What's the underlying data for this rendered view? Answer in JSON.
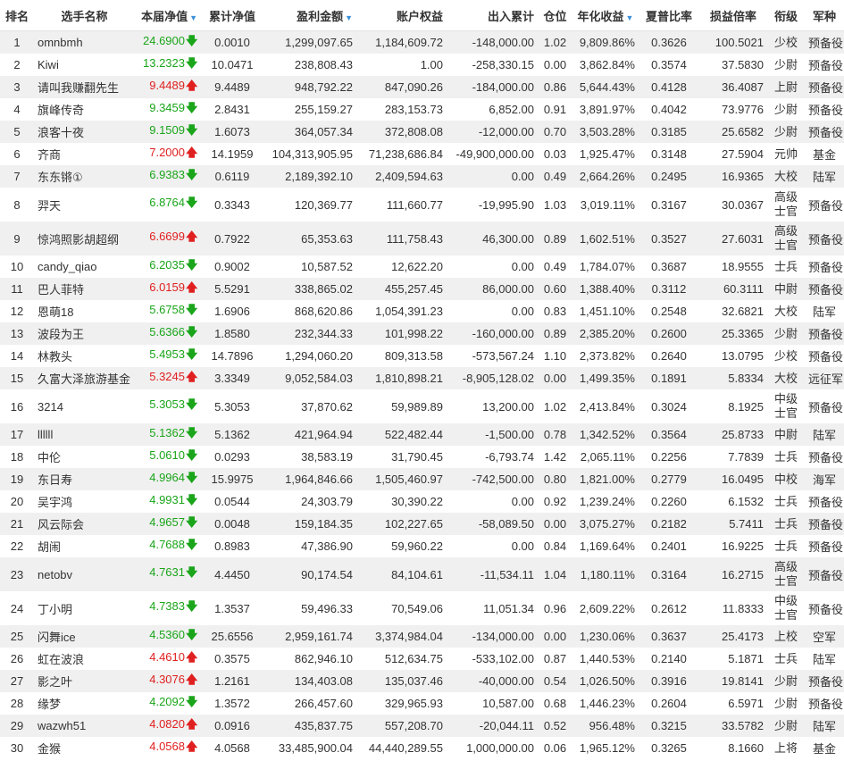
{
  "headers": [
    {
      "label": "排名",
      "sort": false
    },
    {
      "label": "选手名称",
      "sort": false
    },
    {
      "label": "本届净值",
      "sort": true
    },
    {
      "label": "累计净值",
      "sort": false
    },
    {
      "label": "盈利金额",
      "sort": true
    },
    {
      "label": "账户权益",
      "sort": false
    },
    {
      "label": "出入累计",
      "sort": false
    },
    {
      "label": "仓位",
      "sort": false
    },
    {
      "label": "年化收益",
      "sort": true
    },
    {
      "label": "夏普比率",
      "sort": false
    },
    {
      "label": "损益倍率",
      "sort": false
    },
    {
      "label": "衔级",
      "sort": false
    },
    {
      "label": "军种",
      "sort": false
    }
  ],
  "sort_arrow": "▼",
  "trend_symbols": {
    "up": "🡅",
    "down": "🡇"
  },
  "colors": {
    "up": "#e02020",
    "down": "#1aa51a",
    "accent": "#3b8fd9",
    "row_alt": "#f0f0f0"
  },
  "rows": [
    {
      "rank": "1",
      "name": "omnbmh",
      "nav": "24.6900",
      "trend": "down",
      "cum": "0.0010",
      "profit": "1,299,097.65",
      "equity": "1,184,609.72",
      "flow": "-148,000.00",
      "pos": "1.02",
      "annual": "9,809.86%",
      "sharpe": "0.3626",
      "pl": "100.5021",
      "title": "少校",
      "branch": "预备役"
    },
    {
      "rank": "2",
      "name": "Kiwi",
      "nav": "13.2323",
      "trend": "down",
      "cum": "10.0471",
      "profit": "238,808.43",
      "equity": "1.00",
      "flow": "-258,330.15",
      "pos": "0.00",
      "annual": "3,862.84%",
      "sharpe": "0.3574",
      "pl": "37.5830",
      "title": "少尉",
      "branch": "预备役"
    },
    {
      "rank": "3",
      "name": "请叫我赚翻先生",
      "nav": "9.4489",
      "trend": "up",
      "cum": "9.4489",
      "profit": "948,792.22",
      "equity": "847,090.26",
      "flow": "-184,000.00",
      "pos": "0.86",
      "annual": "5,644.43%",
      "sharpe": "0.4128",
      "pl": "36.4087",
      "title": "上尉",
      "branch": "预备役"
    },
    {
      "rank": "4",
      "name": "旗峰传奇",
      "nav": "9.3459",
      "trend": "down",
      "cum": "2.8431",
      "profit": "255,159.27",
      "equity": "283,153.73",
      "flow": "6,852.00",
      "pos": "0.91",
      "annual": "3,891.97%",
      "sharpe": "0.4042",
      "pl": "73.9776",
      "title": "少尉",
      "branch": "预备役"
    },
    {
      "rank": "5",
      "name": "浪客十夜",
      "nav": "9.1509",
      "trend": "down",
      "cum": "1.6073",
      "profit": "364,057.34",
      "equity": "372,808.08",
      "flow": "-12,000.00",
      "pos": "0.70",
      "annual": "3,503.28%",
      "sharpe": "0.3185",
      "pl": "25.6582",
      "title": "少尉",
      "branch": "预备役"
    },
    {
      "rank": "6",
      "name": "齐商",
      "nav": "7.2000",
      "trend": "up",
      "cum": "14.1959",
      "profit": "104,313,905.95",
      "equity": "71,238,686.84",
      "flow": "-49,900,000.00",
      "pos": "0.03",
      "annual": "1,925.47%",
      "sharpe": "0.3148",
      "pl": "27.5904",
      "title": "元帅",
      "branch": "基金"
    },
    {
      "rank": "7",
      "name": "东东锵①",
      "nav": "6.9383",
      "trend": "down",
      "cum": "0.6119",
      "profit": "2,189,392.10",
      "equity": "2,409,594.63",
      "flow": "0.00",
      "pos": "0.49",
      "annual": "2,664.26%",
      "sharpe": "0.2495",
      "pl": "16.9365",
      "title": "大校",
      "branch": "陆军"
    },
    {
      "rank": "8",
      "name": "羿天",
      "nav": "6.8764",
      "trend": "down",
      "cum": "0.3343",
      "profit": "120,369.77",
      "equity": "111,660.77",
      "flow": "-19,995.90",
      "pos": "1.03",
      "annual": "3,019.11%",
      "sharpe": "0.3167",
      "pl": "30.0367",
      "title": "高级士官",
      "branch": "预备役"
    },
    {
      "rank": "9",
      "name": "惊鸿照影胡超纲",
      "nav": "6.6699",
      "trend": "up",
      "cum": "0.7922",
      "profit": "65,353.63",
      "equity": "111,758.43",
      "flow": "46,300.00",
      "pos": "0.89",
      "annual": "1,602.51%",
      "sharpe": "0.3527",
      "pl": "27.6031",
      "title": "高级士官",
      "branch": "预备役"
    },
    {
      "rank": "10",
      "name": "candy_qiao",
      "nav": "6.2035",
      "trend": "down",
      "cum": "0.9002",
      "profit": "10,587.52",
      "equity": "12,622.20",
      "flow": "0.00",
      "pos": "0.49",
      "annual": "1,784.07%",
      "sharpe": "0.3687",
      "pl": "18.9555",
      "title": "士兵",
      "branch": "预备役"
    },
    {
      "rank": "11",
      "name": "巴人菲特",
      "nav": "6.0159",
      "trend": "up",
      "cum": "5.5291",
      "profit": "338,865.02",
      "equity": "455,257.45",
      "flow": "86,000.00",
      "pos": "0.60",
      "annual": "1,388.40%",
      "sharpe": "0.3112",
      "pl": "60.3111",
      "title": "中尉",
      "branch": "预备役"
    },
    {
      "rank": "12",
      "name": "恩萌18",
      "nav": "5.6758",
      "trend": "down",
      "cum": "1.6906",
      "profit": "868,620.86",
      "equity": "1,054,391.23",
      "flow": "0.00",
      "pos": "0.83",
      "annual": "1,451.10%",
      "sharpe": "0.2548",
      "pl": "32.6821",
      "title": "大校",
      "branch": "陆军"
    },
    {
      "rank": "13",
      "name": "波段为王",
      "nav": "5.6366",
      "trend": "down",
      "cum": "1.8580",
      "profit": "232,344.33",
      "equity": "101,998.22",
      "flow": "-160,000.00",
      "pos": "0.89",
      "annual": "2,385.20%",
      "sharpe": "0.2600",
      "pl": "25.3365",
      "title": "少尉",
      "branch": "预备役"
    },
    {
      "rank": "14",
      "name": "林教头",
      "nav": "5.4953",
      "trend": "down",
      "cum": "14.7896",
      "profit": "1,294,060.20",
      "equity": "809,313.58",
      "flow": "-573,567.24",
      "pos": "1.10",
      "annual": "2,373.82%",
      "sharpe": "0.2640",
      "pl": "13.0795",
      "title": "少校",
      "branch": "预备役"
    },
    {
      "rank": "15",
      "name": "久富大泽旅游基金",
      "nav": "5.3245",
      "trend": "up",
      "cum": "3.3349",
      "profit": "9,052,584.03",
      "equity": "1,810,898.21",
      "flow": "-8,905,128.02",
      "pos": "0.00",
      "annual": "1,499.35%",
      "sharpe": "0.1891",
      "pl": "5.8334",
      "title": "大校",
      "branch": "远征军"
    },
    {
      "rank": "16",
      "name": "3214",
      "nav": "5.3053",
      "trend": "down",
      "cum": "5.3053",
      "profit": "37,870.62",
      "equity": "59,989.89",
      "flow": "13,200.00",
      "pos": "1.02",
      "annual": "2,413.84%",
      "sharpe": "0.3024",
      "pl": "8.1925",
      "title": "中级士官",
      "branch": "预备役"
    },
    {
      "rank": "17",
      "name": "llllll",
      "nav": "5.1362",
      "trend": "down",
      "cum": "5.1362",
      "profit": "421,964.94",
      "equity": "522,482.44",
      "flow": "-1,500.00",
      "pos": "0.78",
      "annual": "1,342.52%",
      "sharpe": "0.3564",
      "pl": "25.8733",
      "title": "中尉",
      "branch": "陆军"
    },
    {
      "rank": "18",
      "name": "中伦",
      "nav": "5.0610",
      "trend": "down",
      "cum": "0.0293",
      "profit": "38,583.19",
      "equity": "31,790.45",
      "flow": "-6,793.74",
      "pos": "1.42",
      "annual": "2,065.11%",
      "sharpe": "0.2256",
      "pl": "7.7839",
      "title": "士兵",
      "branch": "预备役"
    },
    {
      "rank": "19",
      "name": "东日寿",
      "nav": "4.9964",
      "trend": "down",
      "cum": "15.9975",
      "profit": "1,964,846.66",
      "equity": "1,505,460.97",
      "flow": "-742,500.00",
      "pos": "0.80",
      "annual": "1,821.00%",
      "sharpe": "0.2779",
      "pl": "16.0495",
      "title": "中校",
      "branch": "海军"
    },
    {
      "rank": "20",
      "name": "吴宇鸿",
      "nav": "4.9931",
      "trend": "down",
      "cum": "0.0544",
      "profit": "24,303.79",
      "equity": "30,390.22",
      "flow": "0.00",
      "pos": "0.92",
      "annual": "1,239.24%",
      "sharpe": "0.2260",
      "pl": "6.1532",
      "title": "士兵",
      "branch": "预备役"
    },
    {
      "rank": "21",
      "name": "风云际会",
      "nav": "4.9657",
      "trend": "down",
      "cum": "0.0048",
      "profit": "159,184.35",
      "equity": "102,227.65",
      "flow": "-58,089.50",
      "pos": "0.00",
      "annual": "3,075.27%",
      "sharpe": "0.2182",
      "pl": "5.7411",
      "title": "士兵",
      "branch": "预备役"
    },
    {
      "rank": "22",
      "name": "胡闹",
      "nav": "4.7688",
      "trend": "down",
      "cum": "0.8983",
      "profit": "47,386.90",
      "equity": "59,960.22",
      "flow": "0.00",
      "pos": "0.84",
      "annual": "1,169.64%",
      "sharpe": "0.2401",
      "pl": "16.9225",
      "title": "士兵",
      "branch": "预备役"
    },
    {
      "rank": "23",
      "name": "netobv",
      "nav": "4.7631",
      "trend": "down",
      "cum": "4.4450",
      "profit": "90,174.54",
      "equity": "84,104.61",
      "flow": "-11,534.11",
      "pos": "1.04",
      "annual": "1,180.11%",
      "sharpe": "0.3164",
      "pl": "16.2715",
      "title": "高级士官",
      "branch": "预备役"
    },
    {
      "rank": "24",
      "name": "丁小明",
      "nav": "4.7383",
      "trend": "down",
      "cum": "1.3537",
      "profit": "59,496.33",
      "equity": "70,549.06",
      "flow": "11,051.34",
      "pos": "0.96",
      "annual": "2,609.22%",
      "sharpe": "0.2612",
      "pl": "11.8333",
      "title": "中级士官",
      "branch": "预备役"
    },
    {
      "rank": "25",
      "name": "闪舞ice",
      "nav": "4.5360",
      "trend": "down",
      "cum": "25.6556",
      "profit": "2,959,161.74",
      "equity": "3,374,984.04",
      "flow": "-134,000.00",
      "pos": "0.00",
      "annual": "1,230.06%",
      "sharpe": "0.3637",
      "pl": "25.4173",
      "title": "上校",
      "branch": "空军"
    },
    {
      "rank": "26",
      "name": "虹在波浪",
      "nav": "4.4610",
      "trend": "up",
      "cum": "0.3575",
      "profit": "862,946.10",
      "equity": "512,634.75",
      "flow": "-533,102.00",
      "pos": "0.87",
      "annual": "1,440.53%",
      "sharpe": "0.2140",
      "pl": "5.1871",
      "title": "士兵",
      "branch": "陆军"
    },
    {
      "rank": "27",
      "name": "影之叶",
      "nav": "4.3076",
      "trend": "up",
      "cum": "1.2161",
      "profit": "134,403.08",
      "equity": "135,037.46",
      "flow": "-40,000.00",
      "pos": "0.54",
      "annual": "1,026.50%",
      "sharpe": "0.3916",
      "pl": "19.8141",
      "title": "少尉",
      "branch": "预备役"
    },
    {
      "rank": "28",
      "name": "缘梦",
      "nav": "4.2092",
      "trend": "down",
      "cum": "1.3572",
      "profit": "266,457.60",
      "equity": "329,965.93",
      "flow": "10,587.00",
      "pos": "0.68",
      "annual": "1,446.23%",
      "sharpe": "0.2604",
      "pl": "6.5971",
      "title": "少尉",
      "branch": "预备役"
    },
    {
      "rank": "29",
      "name": "wazwh51",
      "nav": "4.0820",
      "trend": "up",
      "cum": "0.0916",
      "profit": "435,837.75",
      "equity": "557,208.70",
      "flow": "-20,044.11",
      "pos": "0.52",
      "annual": "956.48%",
      "sharpe": "0.3215",
      "pl": "33.5782",
      "title": "少尉",
      "branch": "陆军"
    },
    {
      "rank": "30",
      "name": "金猴",
      "nav": "4.0568",
      "trend": "up",
      "cum": "4.0568",
      "profit": "33,485,900.04",
      "equity": "44,440,289.55",
      "flow": "1,000,000.00",
      "pos": "0.06",
      "annual": "1,965.12%",
      "sharpe": "0.3265",
      "pl": "8.1660",
      "title": "上将",
      "branch": "基金"
    }
  ]
}
